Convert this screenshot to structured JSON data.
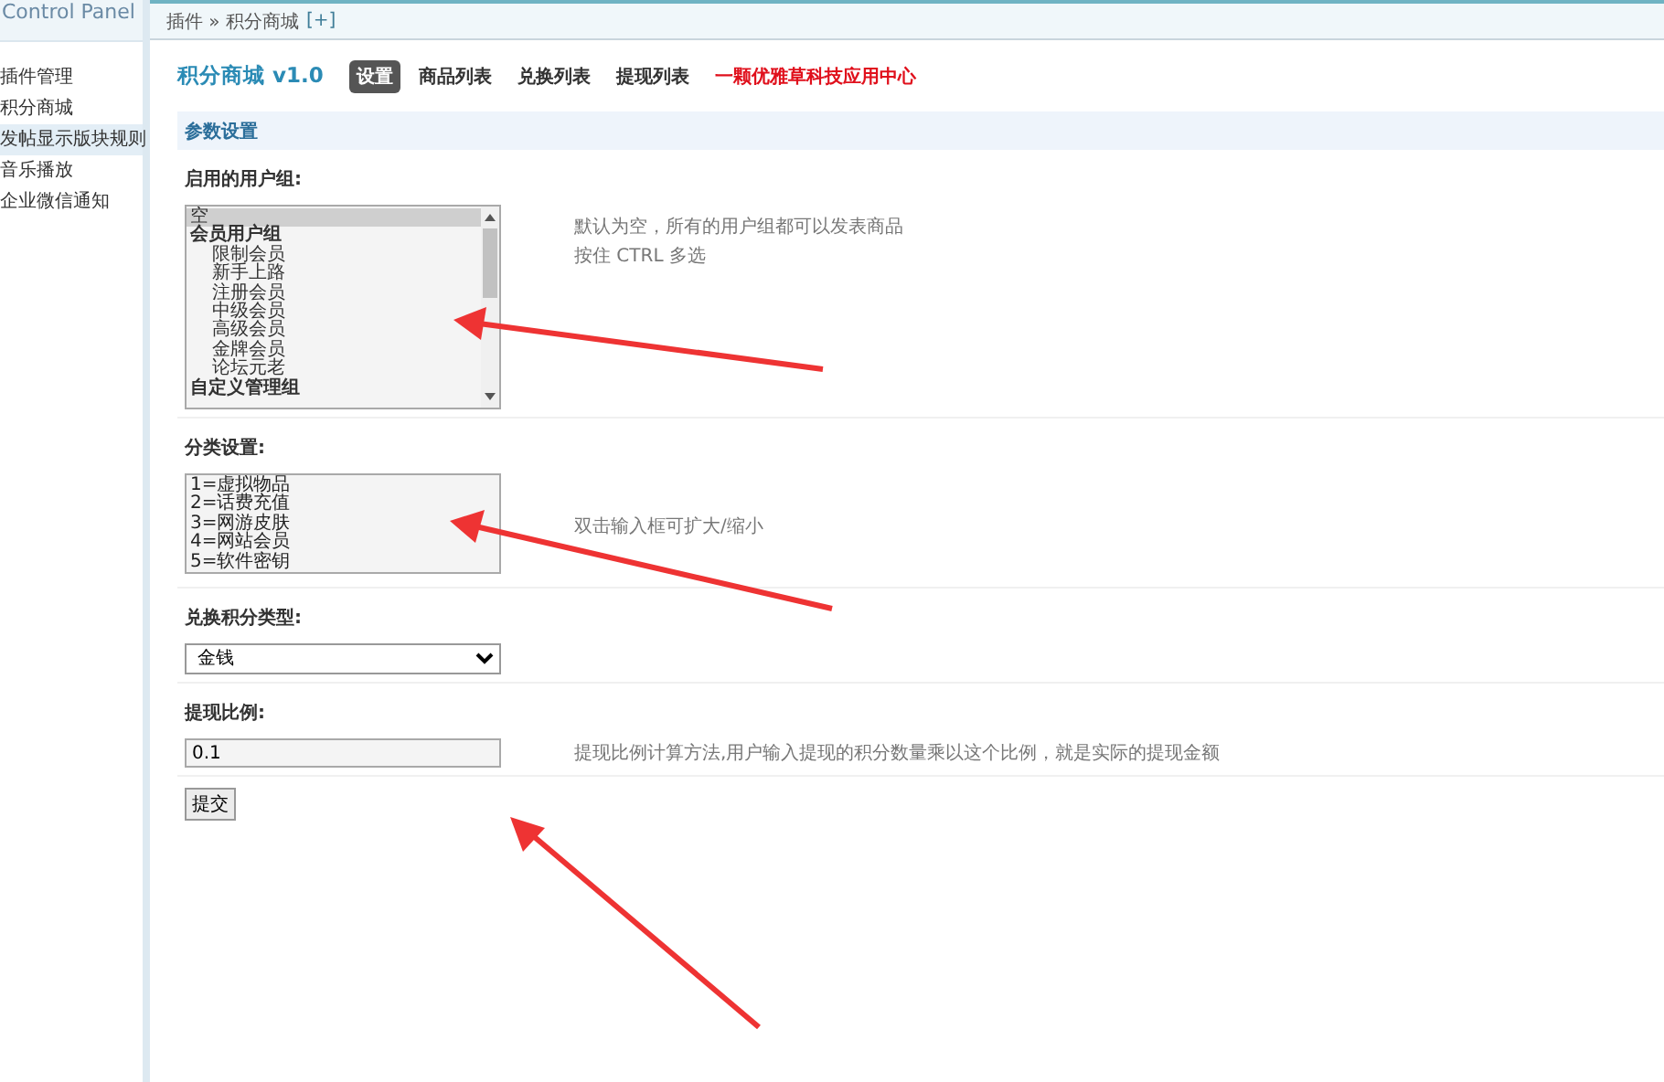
{
  "sidebar": {
    "title": "Control Panel",
    "items": [
      {
        "label": "插件管理",
        "selected": false
      },
      {
        "label": "积分商城",
        "selected": false
      },
      {
        "label": "发帖显示版块规则",
        "selected": true
      },
      {
        "label": "音乐播放",
        "selected": false
      },
      {
        "label": "企业微信通知",
        "selected": false
      }
    ]
  },
  "breadcrumb": {
    "path": "插件 » 积分商城",
    "add": "[+]"
  },
  "plugin": {
    "title": "积分商城 v1.0",
    "tabs": [
      {
        "label": "设置",
        "selected": true
      },
      {
        "label": "商品列表",
        "selected": false
      },
      {
        "label": "兑换列表",
        "selected": false
      },
      {
        "label": "提现列表",
        "selected": false
      }
    ],
    "promo_link": "一颗优雅草科技应用中心"
  },
  "section_title": "参数设置",
  "settings": [
    {
      "kind": "listbox",
      "label": "启用的用户组:",
      "options": [
        {
          "label": "空",
          "kind": "plain",
          "selected": true
        },
        {
          "label": "会员用户组",
          "kind": "group",
          "selected": false
        },
        {
          "label": "限制会员",
          "kind": "member",
          "selected": false
        },
        {
          "label": "新手上路",
          "kind": "member",
          "selected": false
        },
        {
          "label": "注册会员",
          "kind": "member",
          "selected": false
        },
        {
          "label": "中级会员",
          "kind": "member",
          "selected": false
        },
        {
          "label": "高级会员",
          "kind": "member",
          "selected": false
        },
        {
          "label": "金牌会员",
          "kind": "member",
          "selected": false
        },
        {
          "label": "论坛元老",
          "kind": "member",
          "selected": false
        },
        {
          "label": "自定义管理组",
          "kind": "group",
          "selected": false
        }
      ],
      "hints": [
        "默认为空，所有的用户组都可以发表商品",
        "按住 CTRL 多选"
      ]
    },
    {
      "kind": "textarea",
      "label": "分类设置:",
      "value": "1=虚拟物品\n2=话费充值\n3=网游皮肤\n4=网站会员\n5=软件密钥",
      "hints": [
        "双击输入框可扩大/缩小"
      ]
    },
    {
      "kind": "select",
      "label": "兑换积分类型:",
      "value": "金钱"
    },
    {
      "kind": "input",
      "label": "提现比例:",
      "value": "0.1",
      "hints": [
        "提现比例计算方法,用户输入提现的积分数量乘以这个比例，就是实际的提现金额"
      ]
    }
  ],
  "submit": "提交"
}
